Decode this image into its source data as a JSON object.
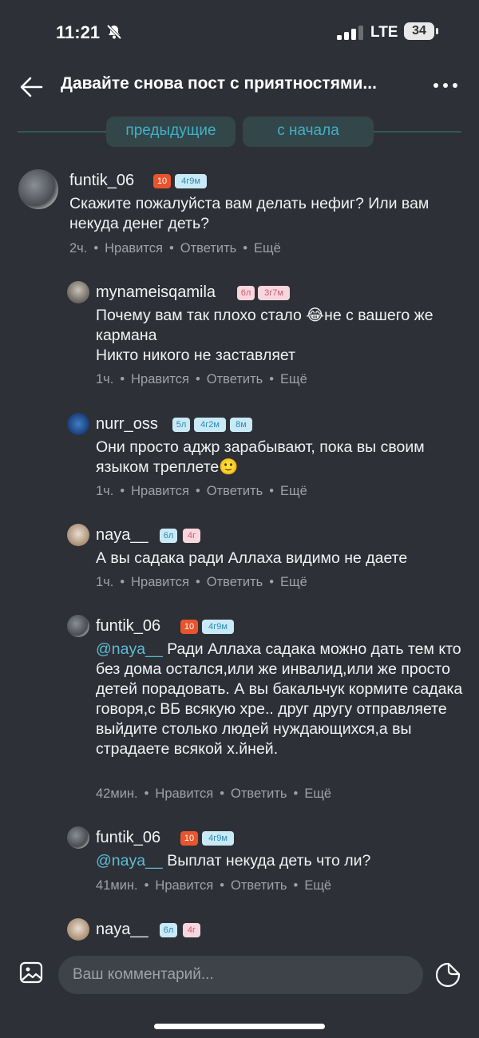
{
  "status": {
    "time": "11:21",
    "network": "LTE",
    "battery": "34"
  },
  "header": {
    "title": "Давайте снова пост с приятностями..."
  },
  "nav": {
    "prev": "предыдущие",
    "start": "с начала"
  },
  "comments": [
    {
      "user": "funtik_06",
      "badges": [
        "10",
        "4г9м"
      ],
      "text": "Скажите пожалуйста вам делать нефиг? Или вам некуда денег деть?",
      "mention": "",
      "time": "2ч.",
      "like": "Нравится",
      "reply": "Ответить",
      "more": "Ещё"
    },
    {
      "user": "mynameisqamila",
      "badges": [
        "6л",
        "3г7м"
      ],
      "text": "Почему вам так плохо стало 😂не с вашего же кармана\nНикто никого не заставляет",
      "mention": "",
      "time": "1ч.",
      "like": "Нравится",
      "reply": "Ответить",
      "more": "Ещё"
    },
    {
      "user": "nurr_oss",
      "badges": [
        "5л",
        "4г2м",
        "8м"
      ],
      "text": "Они просто аджр зарабывают, пока вы своим языком треплете🙂",
      "mention": "",
      "time": "1ч.",
      "like": "Нравится",
      "reply": "Ответить",
      "more": "Ещё"
    },
    {
      "user": "naya__",
      "badges": [
        "6л",
        "4г"
      ],
      "text": "А вы садака ради Аллаха видимо не даете",
      "mention": "",
      "time": "1ч.",
      "like": "Нравится",
      "reply": "Ответить",
      "more": "Ещё"
    },
    {
      "user": "funtik_06",
      "badges": [
        "10",
        "4г9м"
      ],
      "mention": "@naya__",
      "text": " Ради Аллаха садака можно дать тем кто без дома остался,или же инвалид,или же просто детей порадовать. А вы бакальчук кормите садака говоря,с ВБ всякую хре.. друг другу отправляете выйдите столько людей нуждающихся,а вы страдаете всякой х.йней.",
      "time": "42мин.",
      "like": "Нравится",
      "reply": "Ответить",
      "more": "Ещё"
    },
    {
      "user": "funtik_06",
      "badges": [
        "10",
        "4г9м"
      ],
      "mention": "@naya__",
      "text": " Выплат некуда деть что ли?",
      "time": "41мин.",
      "like": "Нравится",
      "reply": "Ответить",
      "more": "Ещё"
    },
    {
      "user": "naya__",
      "badges": [
        "6л",
        "4г"
      ],
      "mention": "",
      "text": "",
      "time": "",
      "like": "",
      "reply": "",
      "more": ""
    }
  ],
  "composer": {
    "placeholder": "Ваш комментарий..."
  },
  "colors": {
    "background": "#2d3036",
    "accent": "#3fb1c7",
    "badge_orange": "#e9542d",
    "badge_blue": "#c9e9f6",
    "badge_pink": "#f7d6dd"
  },
  "icons": [
    "bell-off-icon",
    "signal-icon",
    "battery-icon",
    "back-arrow-icon",
    "more-icon",
    "image-icon",
    "sticker-icon"
  ]
}
